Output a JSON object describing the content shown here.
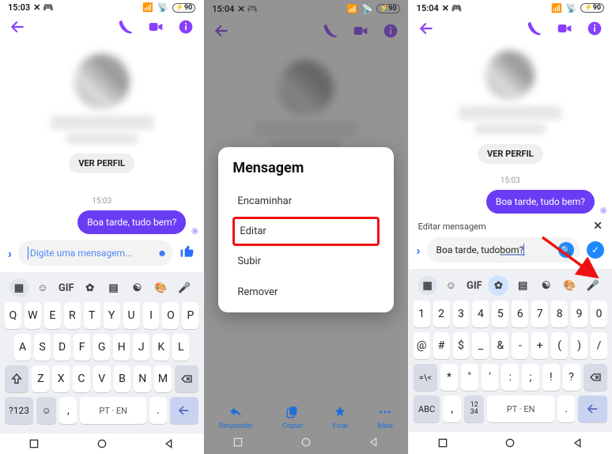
{
  "screen1": {
    "status": {
      "time": "15:03",
      "battery": "90"
    },
    "appbar": {
      "back": "back",
      "call": "call",
      "video": "video",
      "info": "info"
    },
    "profile_button": "VER PERFIL",
    "timestamp": "15:03",
    "message": "Boa tarde, tudo bem?",
    "composer": {
      "placeholder": "Digite uma mensagem..."
    },
    "keyboard": {
      "gif": "GIF",
      "lang": "PT · EN",
      "mode": "?123",
      "rows": [
        [
          "Q",
          "W",
          "E",
          "R",
          "T",
          "Y",
          "U",
          "I",
          "O",
          "P"
        ],
        [
          "A",
          "S",
          "D",
          "F",
          "G",
          "H",
          "J",
          "K",
          "L"
        ],
        [
          "Z",
          "X",
          "C",
          "V",
          "B",
          "N",
          "M"
        ]
      ],
      "comma": ",",
      "period": "."
    }
  },
  "screen2": {
    "status": {
      "time": "15:04",
      "battery": "90"
    },
    "modal": {
      "title": "Mensagem",
      "options": [
        "Encaminhar",
        "Editar",
        "Subir",
        "Remover"
      ],
      "highlight_index": 1
    },
    "actions": [
      "Responder",
      "Copiar",
      "Fixar",
      "Mais"
    ]
  },
  "screen3": {
    "status": {
      "time": "15:04",
      "battery": "90"
    },
    "profile_button": "VER PERFIL",
    "timestamp": "15:03",
    "message": "Boa tarde, tudo bem?",
    "edit_label": "Editar mensagem",
    "edit_value_prefix": "Boa tarde, tudo ",
    "edit_value_underlined": "bom?",
    "keyboard": {
      "gif": "GIF",
      "lang": "PT · EN",
      "abc": "ABC",
      "numfrac": "1234",
      "rows": [
        [
          "1",
          "2",
          "3",
          "4",
          "5",
          "6",
          "7",
          "8",
          "9",
          "0"
        ],
        [
          "@",
          "#",
          "$",
          "_",
          "&",
          "-",
          "+",
          "(",
          ")",
          "/"
        ],
        [
          "*",
          "\"",
          "'",
          ":",
          ";",
          "!",
          "?"
        ]
      ],
      "symshift": "=\\<",
      "comma": ",",
      "period": "."
    }
  }
}
